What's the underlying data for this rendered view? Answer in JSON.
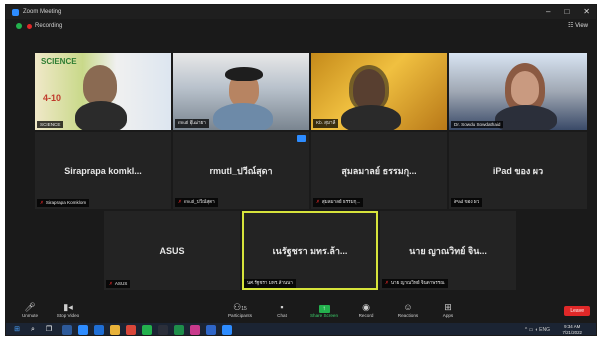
{
  "window": {
    "title": "Zoom Meeting",
    "minimize": "–",
    "maximize": "□",
    "close": "✕"
  },
  "infobar": {
    "recording_label": "Recording",
    "view_label": "☷ View"
  },
  "tiles": [
    {
      "name": "SCIENCE",
      "center": ""
    },
    {
      "name": "rmutl อุ๊เฒ่ายา",
      "center": ""
    },
    {
      "name": "Kb. สุมาลี",
      "center": ""
    },
    {
      "name": "Dr. Sowdu Sowdathaid",
      "center": ""
    },
    {
      "name": "Siraprapa Komklom",
      "center": "Siraprapa  komkl..."
    },
    {
      "name": "rmutl_ปวีณ์สุดา",
      "center": "rmutl_ปวีณ์สุดา"
    },
    {
      "name": "สุมลมาลย์ ธรรมกุ...",
      "center": "สุมลมาลย์ ธรรมกุ..."
    },
    {
      "name": "iPad ของ ผว",
      "center": "iPad ของ ผว"
    },
    {
      "name": "ASUS",
      "center": "ASUS"
    },
    {
      "name": "นศ.รัฐชรา มทร.ล้านนา",
      "center": "เนรัฐชรา มทร.ล้า..."
    },
    {
      "name": "นาย ญาณวิทย์ จินดาพรรณ",
      "center": "นาย ญาณวิทย์ จิน..."
    }
  ],
  "video_tile_text": {
    "science": "SCIENCE",
    "dates": "4-10"
  },
  "toolbar": {
    "unmute": "Unmute",
    "stop_video": "Stop Video",
    "participants": "Participants",
    "participants_count": "15",
    "chat": "Chat",
    "share_screen": "Share Screen",
    "record": "Record",
    "reactions": "Reactions",
    "apps": "Apps",
    "leave": "Leave"
  },
  "taskbar": {
    "time": "9:34 AM",
    "date": "7/21/2022",
    "tray_lang": "ENG"
  },
  "colors": {
    "active_speaker": "#d6e33b",
    "leave": "#e02828",
    "share": "#23b14d",
    "taskbar": "#1b2433"
  }
}
